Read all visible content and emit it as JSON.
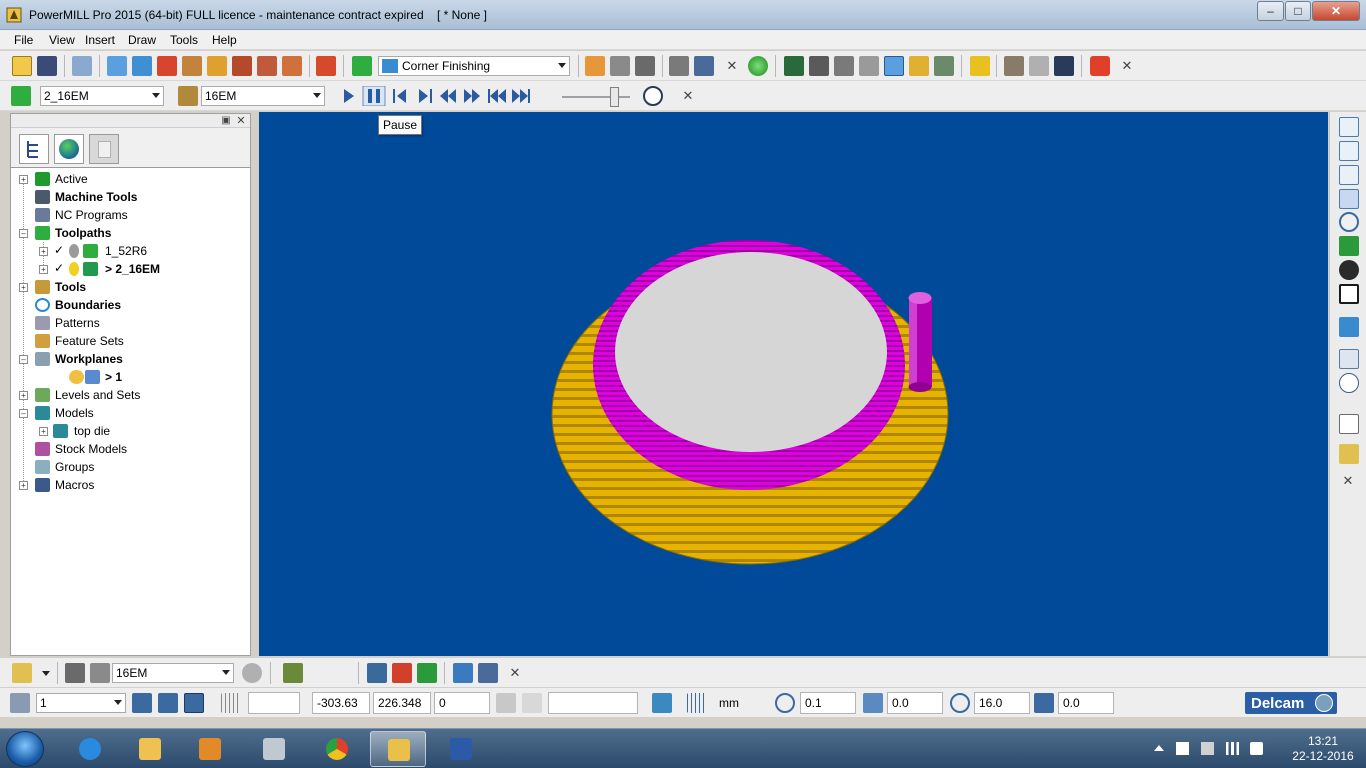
{
  "window": {
    "title": "PowerMILL Pro 2015 (64-bit) FULL licence - maintenance contract expired    [ * None ]"
  },
  "menu": [
    "File",
    "View",
    "Insert",
    "Draw",
    "Tools",
    "Help"
  ],
  "toolbar1": {
    "strategy_combo": "Corner Finishing"
  },
  "toolbar2": {
    "toolpath_combo": "2_16EM",
    "tool_combo": "16EM"
  },
  "tooltip": {
    "text": "Pause"
  },
  "explorer": {
    "items": [
      {
        "label": "Active",
        "bold": false
      },
      {
        "label": "Machine Tools",
        "bold": true
      },
      {
        "label": "NC Programs",
        "bold": false
      },
      {
        "label": "Toolpaths",
        "bold": true
      },
      {
        "label": "1_52R6",
        "bold": false
      },
      {
        "label": "> 2_16EM",
        "bold": true
      },
      {
        "label": "Tools",
        "bold": true
      },
      {
        "label": "Boundaries",
        "bold": true
      },
      {
        "label": "Patterns",
        "bold": false
      },
      {
        "label": "Feature Sets",
        "bold": false
      },
      {
        "label": "Workplanes",
        "bold": true
      },
      {
        "label": "> 1",
        "bold": true
      },
      {
        "label": "Levels and Sets",
        "bold": false
      },
      {
        "label": "Models",
        "bold": false
      },
      {
        "label": "top die",
        "bold": false
      },
      {
        "label": "Stock Models",
        "bold": false
      },
      {
        "label": "Groups",
        "bold": false
      },
      {
        "label": "Macros",
        "bold": false
      }
    ]
  },
  "bottom_toolbar": {
    "tool_combo": "16EM"
  },
  "status": {
    "workplane": "1",
    "x": "-303.63",
    "y": "226.348",
    "z": "0",
    "units": "mm",
    "tolerance": "0.1",
    "thickness": "0.0",
    "diameter": "16.0",
    "angle": "0.0",
    "brand": "Delcam"
  },
  "taskbar": {
    "time": "13:21",
    "date": "22-12-2016"
  },
  "colors": {
    "viewport_bg": "#004a99",
    "model_yellow": "#e6b400",
    "model_magenta": "#e000e0",
    "model_top": "#d6d6d6",
    "tool_purple": "#b000b0"
  }
}
